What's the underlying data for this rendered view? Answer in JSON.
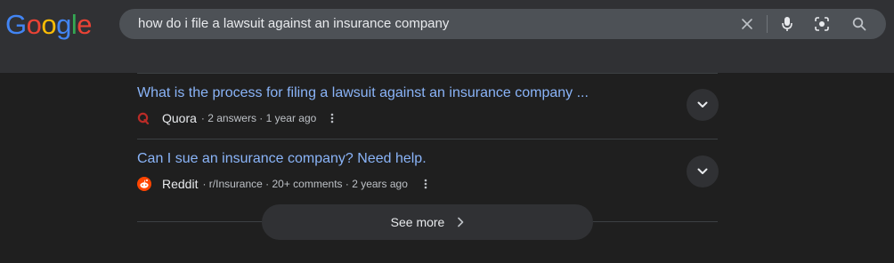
{
  "logo": {
    "letters": [
      "G",
      "o",
      "o",
      "g",
      "l",
      "e"
    ],
    "colors": [
      "#4285f4",
      "#ea4335",
      "#fbbc05",
      "#4285f4",
      "#34a853",
      "#ea4335"
    ]
  },
  "search": {
    "query": "how do i file a lawsuit against an insurance company",
    "icons": [
      "close-icon",
      "mic-icon",
      "lens-icon",
      "search-icon"
    ]
  },
  "results": [
    {
      "title": "What is the process for filing a lawsuit against an insurance company ...",
      "source": "Quora",
      "sub": "· 2 answers · 1 year ago",
      "icon": "quora-icon",
      "icon_color": "#b92b27"
    },
    {
      "title": "Can I sue an insurance company? Need help.",
      "source": "Reddit",
      "sub": "· r/Insurance · 20+ comments · 2 years ago",
      "icon": "reddit-icon",
      "icon_color": "#ff4500"
    }
  ],
  "see_more": {
    "label": "See more"
  },
  "colors": {
    "link": "#8ab4f8",
    "background": "#1f1f1f",
    "header": "#303134",
    "searchbox": "#4d5156"
  }
}
